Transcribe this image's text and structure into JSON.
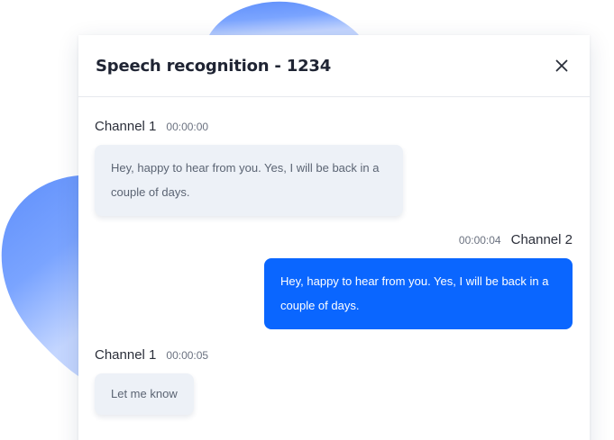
{
  "dialog": {
    "title": "Speech recognition - 1234",
    "close_icon": "close-icon"
  },
  "colors": {
    "accent": "#0a66ff",
    "incoming_bubble": "#edf1f7",
    "blob": "#6f9cff"
  },
  "messages": [
    {
      "channel": "Channel 1",
      "time": "00:00:00",
      "text": "Hey, happy to hear from you. Yes, I will be back in a couple of days.",
      "direction": "incoming"
    },
    {
      "channel": "Channel 2",
      "time": "00:00:04",
      "text": "Hey, happy to hear from you. Yes, I will be back in a couple of days.",
      "direction": "outgoing"
    },
    {
      "channel": "Channel 1",
      "time": "00:00:05",
      "text": "Let me know",
      "direction": "incoming"
    }
  ]
}
